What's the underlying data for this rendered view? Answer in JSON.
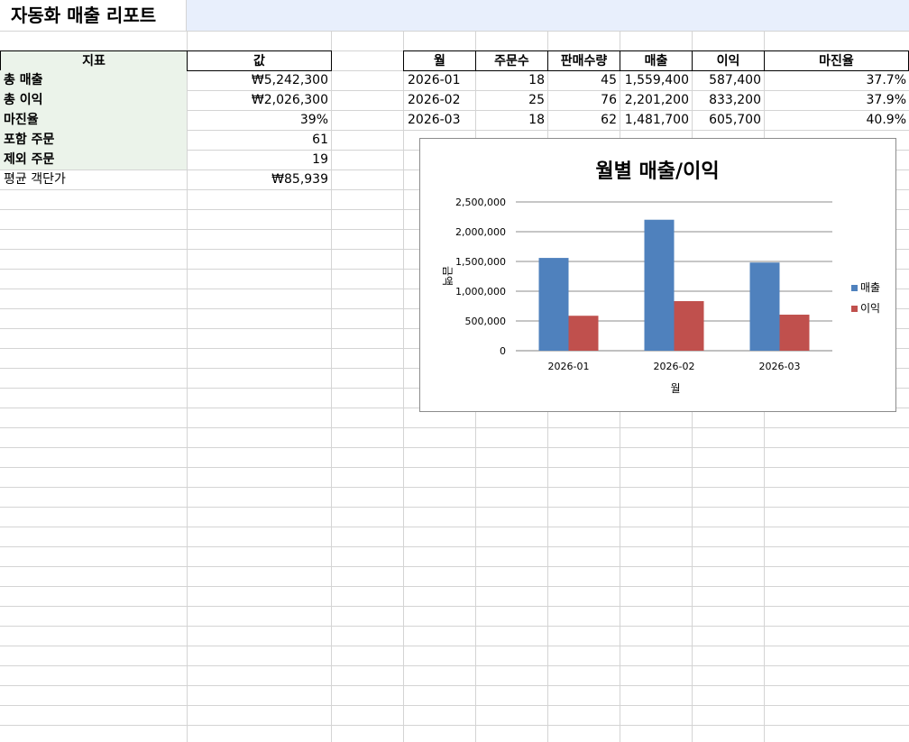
{
  "title": "자동화 매출 리포트",
  "summary": {
    "headers": [
      "지표",
      "값"
    ],
    "rows": [
      {
        "label": "총 매출",
        "value": "₩5,242,300"
      },
      {
        "label": "총 이익",
        "value": "₩2,026,300"
      },
      {
        "label": "마진율",
        "value": "39%"
      },
      {
        "label": "포함 주문",
        "value": "61"
      },
      {
        "label": "제외 주문",
        "value": "19"
      },
      {
        "label": "평균 객단가",
        "value": "₩85,939"
      }
    ]
  },
  "monthly": {
    "headers": [
      "월",
      "주문수",
      "판매수량",
      "매출",
      "이익",
      "마진율"
    ],
    "rows": [
      [
        "2026-01",
        "18",
        "45",
        "1,559,400",
        "587,400",
        "37.7%"
      ],
      [
        "2026-02",
        "25",
        "76",
        "2,201,200",
        "833,200",
        "37.9%"
      ],
      [
        "2026-03",
        "18",
        "62",
        "1,481,700",
        "605,700",
        "40.9%"
      ]
    ]
  },
  "colors": {
    "title_bar_bg": "#e8effc",
    "summary_label_bg": "#ebf3ea",
    "series_revenue": "#4f81bd",
    "series_profit": "#c0504d"
  },
  "chart_data": {
    "type": "bar",
    "title": "월별 매출/이익",
    "xlabel": "월",
    "ylabel": "금액",
    "categories": [
      "2026-01",
      "2026-02",
      "2026-03"
    ],
    "series": [
      {
        "name": "매출",
        "values": [
          1559400,
          2201200,
          1481700
        ]
      },
      {
        "name": "이익",
        "values": [
          587400,
          833200,
          605700
        ]
      }
    ],
    "ylim": [
      0,
      2500000
    ],
    "yticks": [
      0,
      500000,
      1000000,
      1500000,
      2000000,
      2500000
    ],
    "ytick_labels": [
      "0",
      "500,000",
      "1,000,000",
      "1,500,000",
      "2,000,000",
      "2,500,000"
    ],
    "grid": true,
    "legend": "right"
  }
}
